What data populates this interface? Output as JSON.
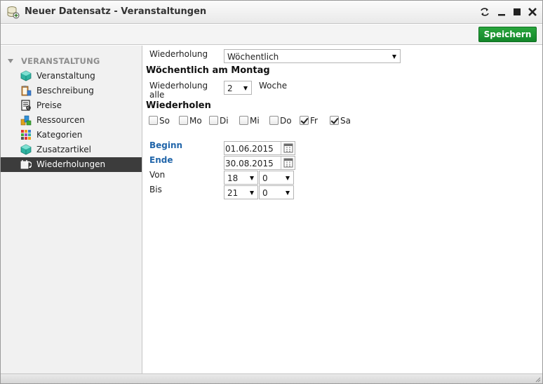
{
  "window": {
    "title": "Neuer Datensatz - Veranstaltungen",
    "controls": [
      "restore-arrows-icon",
      "minimize-icon",
      "maximize-icon",
      "close-icon"
    ]
  },
  "toolbar": {
    "save_label": "Speichern",
    "save_color": "#1a9a32"
  },
  "sidebar": {
    "header": "VERANSTALTUNG",
    "items": [
      {
        "label": "Veranstaltung",
        "icon": "cube-icon",
        "active": false
      },
      {
        "label": "Beschreibung",
        "icon": "clipboard-icon",
        "active": false
      },
      {
        "label": "Preise",
        "icon": "price-list-icon",
        "active": false
      },
      {
        "label": "Ressourcen",
        "icon": "resources-icon",
        "active": false
      },
      {
        "label": "Kategorien",
        "icon": "categories-icon",
        "active": false
      },
      {
        "label": "Zusatzartikel",
        "icon": "cube-icon",
        "active": false
      },
      {
        "label": "Wiederholungen",
        "icon": "calendar-repeat-icon",
        "active": true
      }
    ],
    "active_color": "#3c3c3c"
  },
  "form": {
    "repeat_label": "Wiederholung",
    "repeat_value": "Wöchentlich",
    "weekly_heading": "Wöchentlich am Montag",
    "every_label_1": "Wiederholung",
    "every_label_2": "alle",
    "every_value": "2",
    "every_unit": "Woche",
    "repeat_days_heading": "Wiederholen",
    "days": [
      {
        "label": "So",
        "checked": false
      },
      {
        "label": "Mo",
        "checked": false
      },
      {
        "label": "Di",
        "checked": false
      },
      {
        "label": "Mi",
        "checked": false
      },
      {
        "label": "Do",
        "checked": false
      },
      {
        "label": "Fr",
        "checked": true
      },
      {
        "label": "Sa",
        "checked": true
      }
    ],
    "begin_label": "Beginn",
    "begin_value": "01.06.2015",
    "end_label": "Ende",
    "end_value": "30.08.2015",
    "from_label": "Von",
    "from_hour": "18",
    "from_minute": "0",
    "to_label": "Bis",
    "to_hour": "21",
    "to_minute": "0",
    "label_blue": "#2266aa"
  }
}
